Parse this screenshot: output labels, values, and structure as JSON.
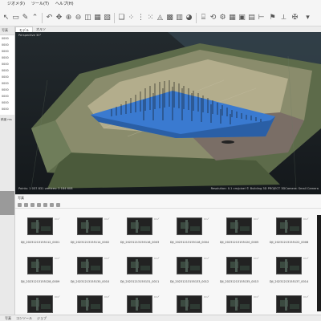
{
  "menubar": {
    "items": [
      {
        "label": "ジオメタ)"
      },
      {
        "label": "ツール(T)"
      },
      {
        "label": "ヘルプ(H)"
      }
    ]
  },
  "tabs": [
    {
      "label": "モデル",
      "active": true
    },
    {
      "label": "オルソ",
      "active": false
    }
  ],
  "left_panel": {
    "header": "写真",
    "rows": [
      "0000",
      "0000",
      "0000",
      "0000",
      "0000",
      "0000",
      "0000",
      "0000",
      "0000",
      "0000",
      "0000",
      "0000"
    ],
    "footer": "精度 ms"
  },
  "viewport": {
    "top_label": "Perspective 30°",
    "bottom_left": "Points: 1 037 831 vertices: 2 184 608",
    "bottom_right": "Resolution: 0.1 cm/pixel © Building 3D PROJECT 3DCamera: Small Camera"
  },
  "photos_panel": {
    "title": "写真",
    "thumbnails": [
      "DJI_20231213155112_0001",
      "DJI_20231213155114_0002",
      "DJI_20231213155116_0003",
      "DJI_20231213155118_0004",
      "DJI_20231213155120_0005",
      "DJI_20231213155122_0006",
      "DJI_20231213155128_0009",
      "DJI_20231213155130_0010",
      "DJI_20231213155131_0011",
      "DJI_20231213155133_0012",
      "DJI_20231213155135_0013",
      "DJI_20231213155137_0014",
      "",
      "",
      "",
      "",
      "",
      ""
    ]
  },
  "statusbar": {
    "tabs": [
      "写真",
      "コンソール",
      "ジョブ"
    ]
  },
  "icons": {
    "toolbar": [
      "navigate-icon",
      "select-icon",
      "lasso-icon",
      "resize-icon",
      "rotate-icon",
      "zoom-in-icon",
      "zoom-out-icon",
      "fit-icon",
      "move-icon",
      "region-icon",
      "mesh-icon",
      "dense-cloud-icon",
      "tie-points-icon",
      "texture-icon",
      "camera-icon",
      "rotate-view-icon",
      "settings-icon",
      "checker-icon",
      "image-icon",
      "measure-icon",
      "marker-icon"
    ]
  }
}
